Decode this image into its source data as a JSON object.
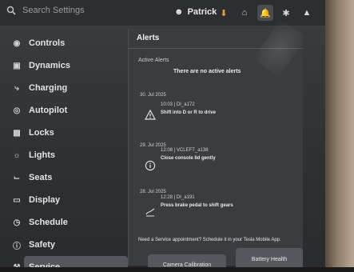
{
  "topbar": {
    "search_placeholder": "Search Settings",
    "user_name": "Patrick"
  },
  "sidebar": {
    "items": [
      {
        "label": "Controls",
        "icon": "toggle-icon"
      },
      {
        "label": "Dynamics",
        "icon": "car-icon"
      },
      {
        "label": "Charging",
        "icon": "bolt-icon"
      },
      {
        "label": "Autopilot",
        "icon": "steering-wheel-icon"
      },
      {
        "label": "Locks",
        "icon": "lock-icon"
      },
      {
        "label": "Lights",
        "icon": "sun-icon"
      },
      {
        "label": "Seats",
        "icon": "seat-icon"
      },
      {
        "label": "Display",
        "icon": "display-icon"
      },
      {
        "label": "Schedule",
        "icon": "clock-icon"
      },
      {
        "label": "Safety",
        "icon": "info-icon"
      },
      {
        "label": "Service",
        "icon": "wrench-icon",
        "selected": true
      }
    ]
  },
  "alerts": {
    "title": "Alerts",
    "active_label": "Active Alerts",
    "no_active": "There are no active alerts",
    "history": [
      {
        "date": "30. Jul 2025",
        "meta": "10:03 | DI_a172",
        "message": "Shift into D or R to drive",
        "icon": "warning-icon"
      },
      {
        "date": "29. Jul 2025",
        "meta": "12:08 | VCLEFT_a138",
        "message": "Close console lid gently",
        "icon": "info-icon"
      },
      {
        "date": "28. Jul 2025",
        "meta": "12:28 | DI_a191",
        "message": "Press brake pedal to shift gears",
        "icon": "brake-foot-icon"
      }
    ],
    "service_question": "Need a Service appointment? Schedule it in your Tesla Mobile App.",
    "buttons": {
      "camera": "Camera Calibration",
      "battery": "Battery Health"
    }
  },
  "colors": {
    "accent_orange": "#e8a13a",
    "panel_bg": "#3a3c40",
    "sidebar_bg": "#2e3033"
  }
}
